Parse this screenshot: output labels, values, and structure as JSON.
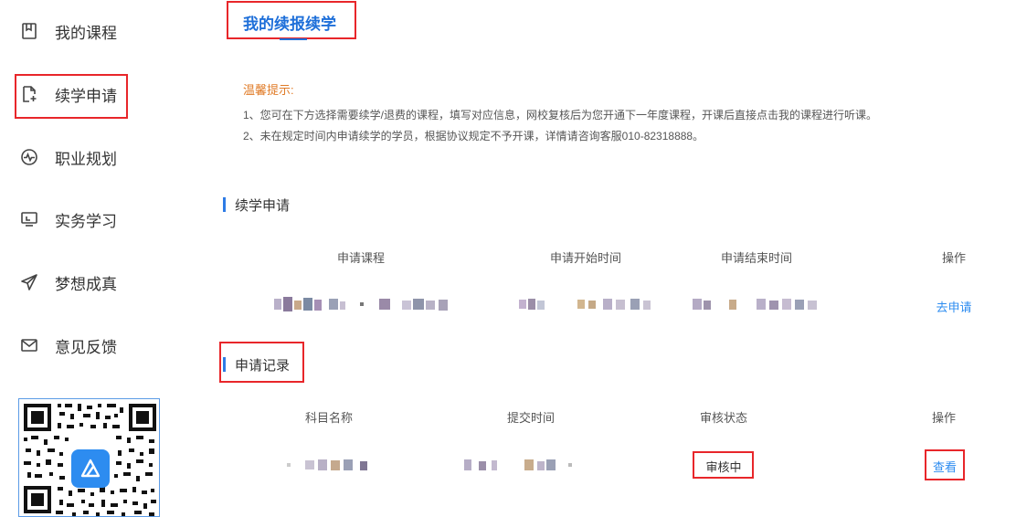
{
  "sidebar": {
    "items": [
      {
        "label": "我的课程",
        "icon": "bookmark-icon"
      },
      {
        "label": "续学申请",
        "icon": "document-add-icon"
      },
      {
        "label": "职业规划",
        "icon": "pulse-icon"
      },
      {
        "label": "实务学习",
        "icon": "monitor-icon"
      },
      {
        "label": "梦想成真",
        "icon": "paper-plane-icon"
      },
      {
        "label": "意见反馈",
        "icon": "mail-icon"
      }
    ]
  },
  "header": {
    "title": "我的续报续学"
  },
  "notice": {
    "title": "温馨提示:",
    "lines": [
      "1、您可在下方选择需要续学/退费的课程，填写对应信息，网校复核后为您开通下一年度课程，开课后直接点击我的课程进行听课。",
      "2、未在规定时间内申请续学的学员，根据协议规定不予开课，详情请咨询客服010-82318888。"
    ]
  },
  "apply_section": {
    "title": "续学申请",
    "columns": [
      "申请课程",
      "申请开始时间",
      "申请结束时间",
      "操作"
    ],
    "row": {
      "action": "去申请"
    }
  },
  "records_section": {
    "title": "申请记录",
    "columns": [
      "科目名称",
      "提交时间",
      "审核状态",
      "操作"
    ],
    "row": {
      "status": "审核中",
      "action": "查看"
    }
  }
}
